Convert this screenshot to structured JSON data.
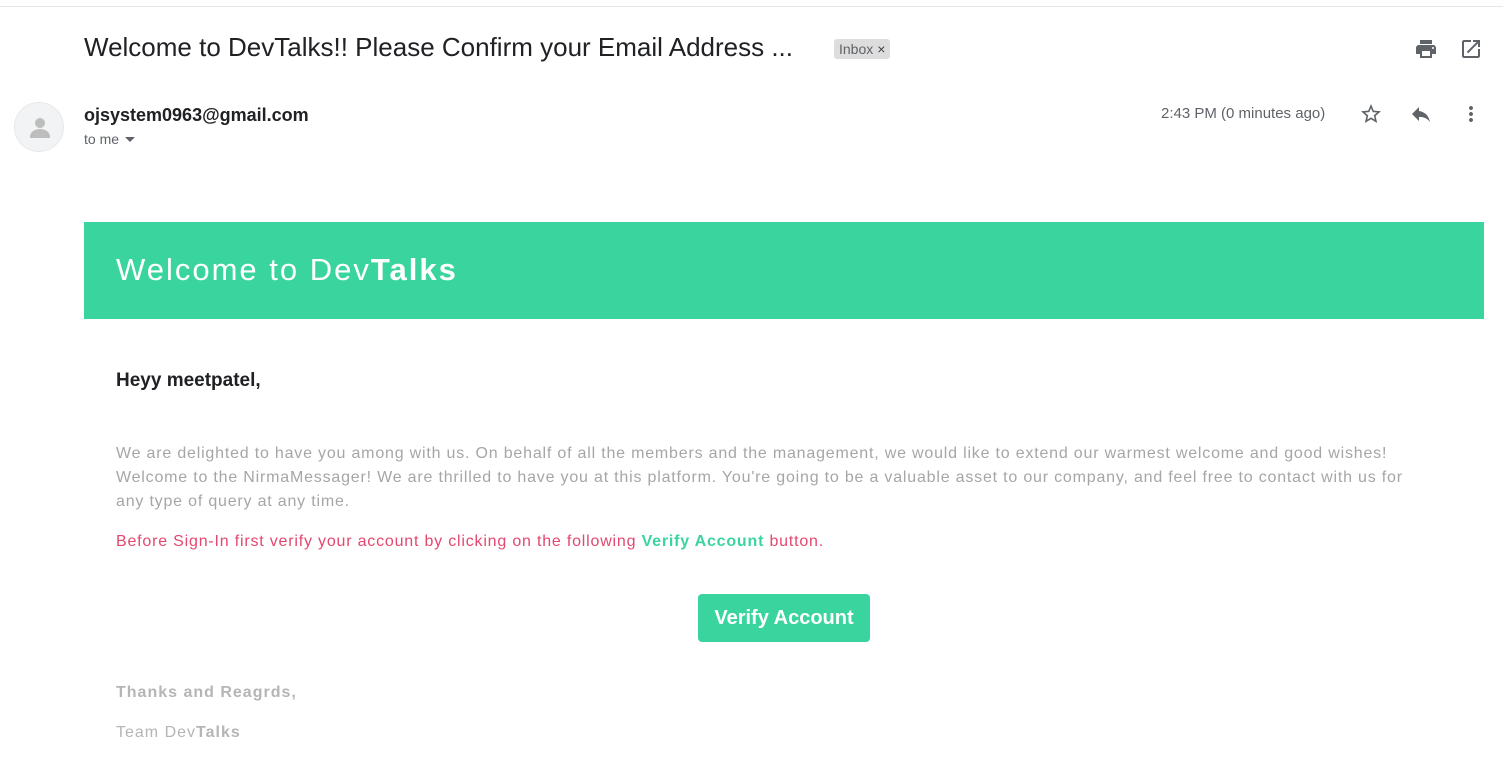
{
  "email": {
    "subject": "Welcome to DevTalks!! Please Confirm your Email Address ...",
    "label": "Inbox",
    "label_remove": "×",
    "sender": "ojsystem0963@gmail.com",
    "recipient": "to me",
    "timestamp": "2:43 PM (0 minutes ago)"
  },
  "toolbar_icons": [
    "print-icon",
    "open-in-new-window-icon",
    "star-icon",
    "reply-icon",
    "more-vertical-icon"
  ],
  "banner": {
    "title_prefix": "Welcome to Dev",
    "title_bold": "Talks",
    "color": "#3ad59f"
  },
  "message": {
    "greeting": "Heyy meetpatel,",
    "paragraph": "We are delighted to have you among with us. On behalf of all the members and the management, we would like to extend our warmest welcome and good wishes! Welcome to the NirmaMessager! We are thrilled to have you at this platform. You're going to be a valuable asset to our company, and feel free to contact with us for any type of query at any time.",
    "verify_prefix": "Before Sign-In first verify your account by clicking on the following ",
    "verify_highlight": "Verify Account",
    "verify_suffix": " button.",
    "button_label": "Verify Account",
    "signoff": "Thanks and Reagrds,",
    "team_prefix": "Team Dev",
    "team_bold": "Talks"
  },
  "colors": {
    "accent": "#3ad59f",
    "warning_text": "#e4476f",
    "muted_text": "#a6a6a6"
  }
}
